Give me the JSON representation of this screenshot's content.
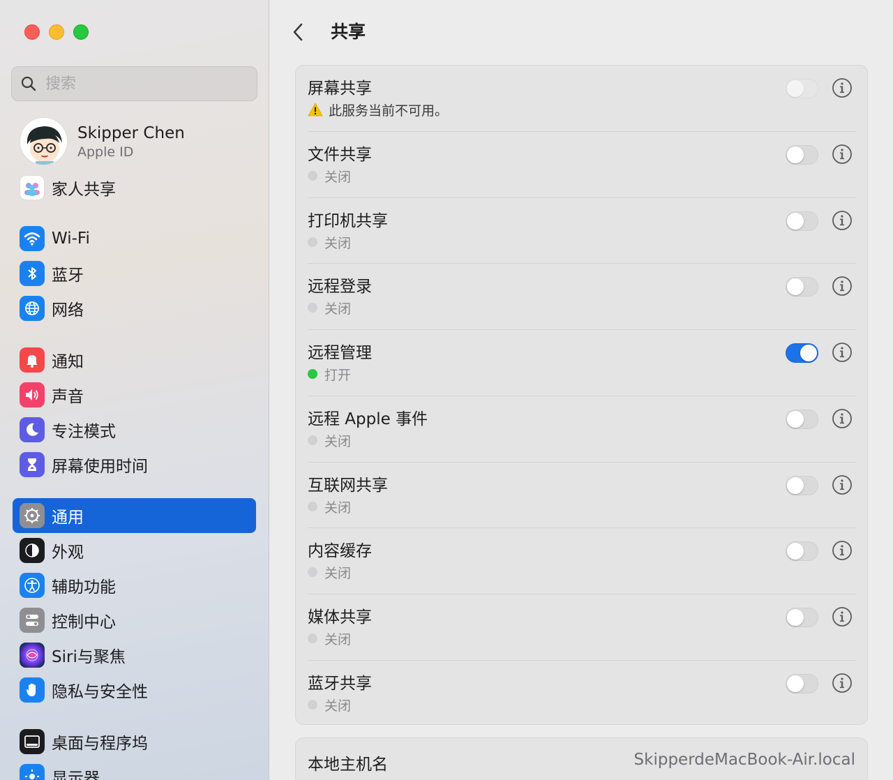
{
  "search": {
    "placeholder": "搜索"
  },
  "profile": {
    "name": "Skipper Chen",
    "subtitle": "Apple ID"
  },
  "sidebar": {
    "items": [
      {
        "label": "家人共享",
        "icon": "family-icon"
      },
      {
        "label": "Wi-Fi",
        "icon": "wifi-icon"
      },
      {
        "label": "蓝牙",
        "icon": "bluetooth-icon"
      },
      {
        "label": "网络",
        "icon": "globe-icon"
      },
      {
        "label": "通知",
        "icon": "bell-icon"
      },
      {
        "label": "声音",
        "icon": "speaker-icon"
      },
      {
        "label": "专注模式",
        "icon": "moon-icon"
      },
      {
        "label": "屏幕使用时间",
        "icon": "hourglass-icon"
      },
      {
        "label": "通用",
        "icon": "gear-icon",
        "active": true
      },
      {
        "label": "外观",
        "icon": "appearance-icon"
      },
      {
        "label": "辅助功能",
        "icon": "accessibility-icon"
      },
      {
        "label": "控制中心",
        "icon": "control-center-icon"
      },
      {
        "label": "Siri与聚焦",
        "icon": "siri-icon"
      },
      {
        "label": "隐私与安全性",
        "icon": "hand-icon"
      },
      {
        "label": "桌面与程序坞",
        "icon": "dock-icon"
      },
      {
        "label": "显示器",
        "icon": "display-icon"
      }
    ]
  },
  "main": {
    "title": "共享",
    "services": [
      {
        "name": "屏幕共享",
        "status": "此服务当前不可用。",
        "state": "unavailable"
      },
      {
        "name": "文件共享",
        "status": "关闭",
        "state": "off"
      },
      {
        "name": "打印机共享",
        "status": "关闭",
        "state": "off"
      },
      {
        "name": "远程登录",
        "status": "关闭",
        "state": "off"
      },
      {
        "name": "远程管理",
        "status": "打开",
        "state": "on"
      },
      {
        "name": "远程 Apple 事件",
        "status": "关闭",
        "state": "off"
      },
      {
        "name": "互联网共享",
        "status": "关闭",
        "state": "off"
      },
      {
        "name": "内容缓存",
        "status": "关闭",
        "state": "off"
      },
      {
        "name": "媒体共享",
        "status": "关闭",
        "state": "off"
      },
      {
        "name": "蓝牙共享",
        "status": "关闭",
        "state": "off"
      }
    ],
    "hostname": {
      "label": "本地主机名",
      "value": "SkipperdeMacBook-Air.local"
    }
  },
  "colors": {
    "accent": "#1565d8",
    "toggle_on": "#1a73e8",
    "status_on": "#28c840",
    "warning": "#f5c400"
  }
}
